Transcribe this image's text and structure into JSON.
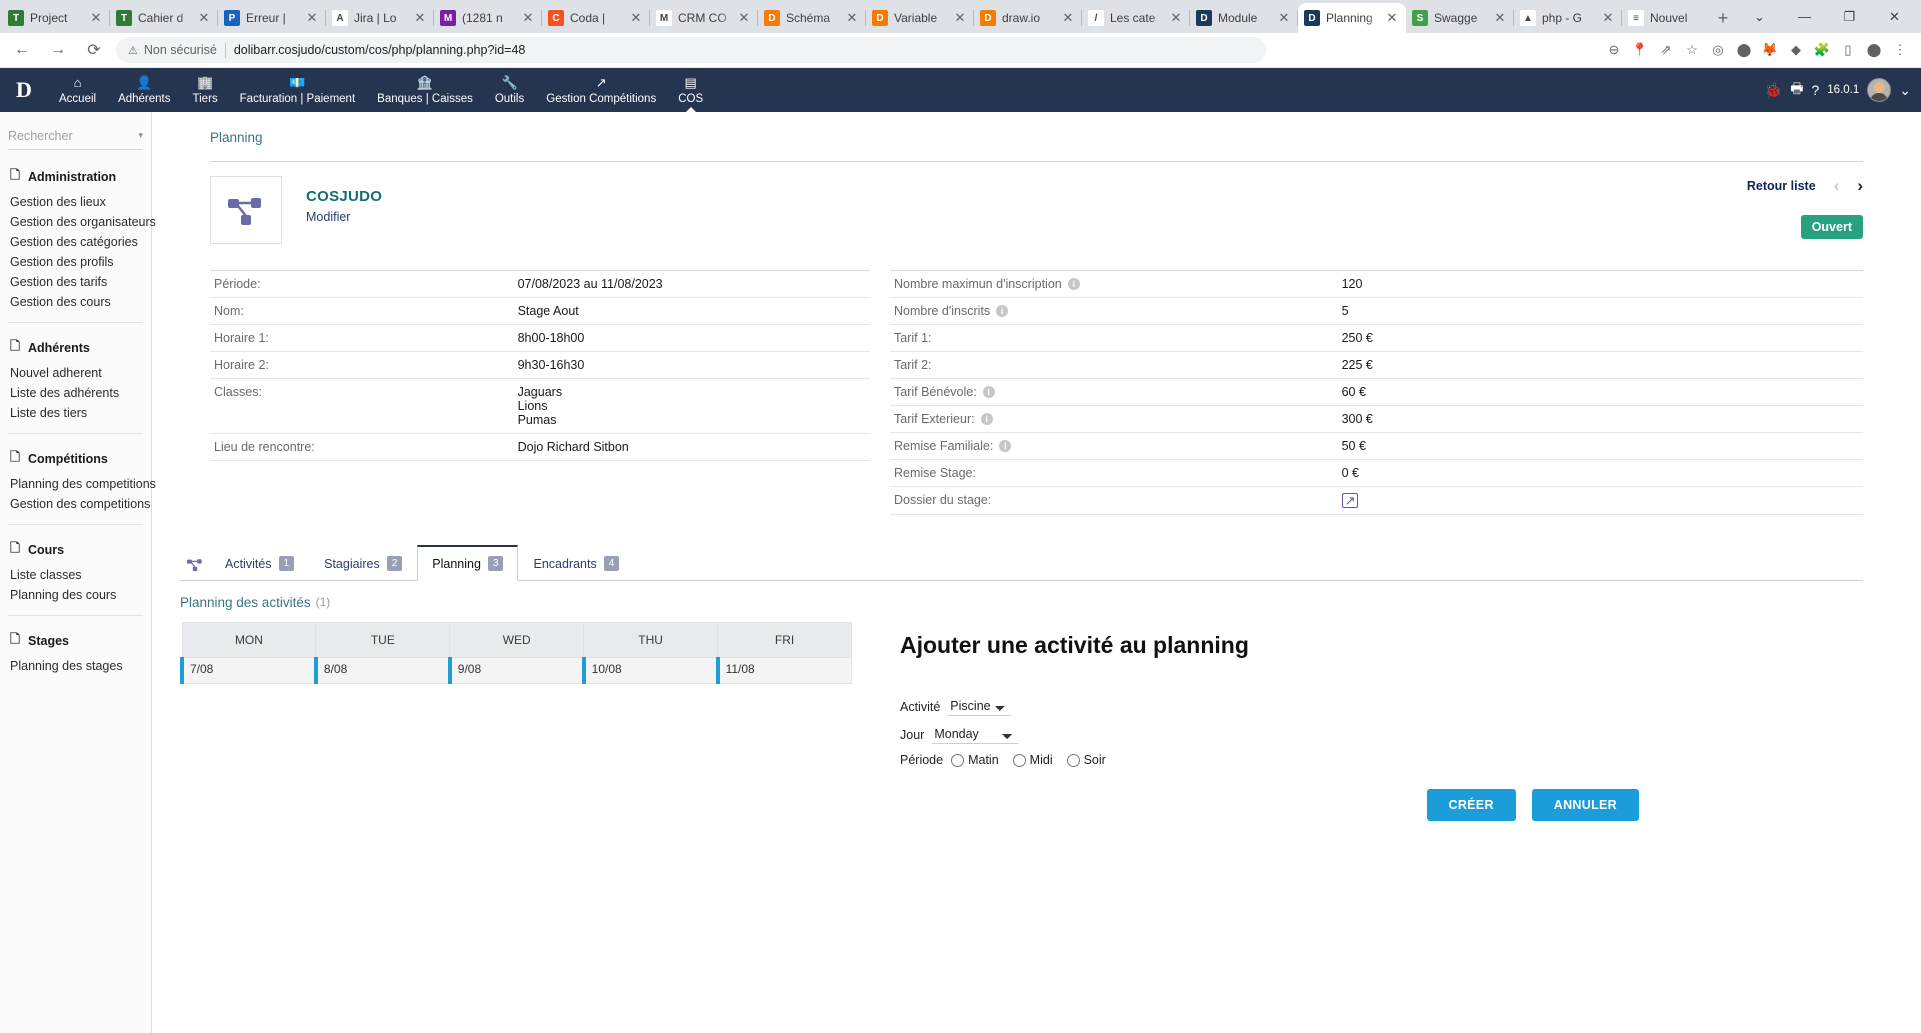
{
  "browser": {
    "tabs": [
      {
        "label": "Project",
        "icon": "trello-icon",
        "color": "#2e7d32",
        "glyph": "T"
      },
      {
        "label": "Cahier d",
        "icon": "trello-icon",
        "color": "#2e7d32",
        "glyph": "T"
      },
      {
        "label": "Erreur |",
        "icon": "pitest-icon",
        "color": "#1565c0",
        "glyph": "P"
      },
      {
        "label": "Jira | Lo",
        "icon": "jira-icon",
        "color": "#ffffff",
        "glyph": "A"
      },
      {
        "label": "(1281 n",
        "icon": "mail-icon",
        "color": "#7b1fa2",
        "glyph": "M"
      },
      {
        "label": "Coda | ",
        "icon": "coda-icon",
        "color": "#f4511e",
        "glyph": "C"
      },
      {
        "label": "CRM CO",
        "icon": "crm-icon",
        "color": "#ffffff",
        "glyph": "M"
      },
      {
        "label": "Schéma",
        "icon": "drawio-icon",
        "color": "#f57c00",
        "glyph": "D"
      },
      {
        "label": "Variable",
        "icon": "drawio-icon",
        "color": "#f57c00",
        "glyph": "D"
      },
      {
        "label": "draw.io",
        "icon": "drawio-icon",
        "color": "#f57c00",
        "glyph": "D"
      },
      {
        "label": "Les cate",
        "icon": "pencil-icon",
        "color": "#ffffff",
        "glyph": "/"
      },
      {
        "label": "Module",
        "icon": "dolibarr-icon",
        "color": "#1a3a5c",
        "glyph": "D"
      },
      {
        "label": "Planning",
        "icon": "dolibarr-icon",
        "color": "#1a3a5c",
        "glyph": "D",
        "active": true
      },
      {
        "label": "Swagge",
        "icon": "swagger-icon",
        "color": "#43a047",
        "glyph": "S"
      },
      {
        "label": "php - G",
        "icon": "drive-icon",
        "color": "#ffffff",
        "glyph": "▲"
      },
      {
        "label": "Nouvel",
        "icon": "sheets-icon",
        "color": "#ffffff",
        "glyph": "≡"
      }
    ],
    "new_tab_glyph": "+",
    "window_controls": [
      "⌄",
      "—",
      "❐",
      "✕"
    ],
    "back_glyph": "←",
    "forward_glyph": "→",
    "reload_glyph": "⟳",
    "security_warning_icon": "⚠",
    "security_label": "Non sécurisé",
    "url": "dolibarr.cosjudo/custom/cos/php/planning.php?id=48",
    "toolbar_icons": [
      "zoom-out-icon",
      "location-icon",
      "share-icon",
      "bookmark-star-icon",
      "pocket-icon",
      "adblock-icon",
      "metamask-icon",
      "extension-purple-icon",
      "puzzle-icon",
      "sidepanel-icon",
      "profile-icon",
      "menu-kebab-icon"
    ]
  },
  "app_navbar": {
    "brand": "D",
    "items": [
      {
        "label": "Accueil",
        "icon": "home-icon",
        "glyph": "⌂"
      },
      {
        "label": "Adhérents",
        "icon": "user-icon",
        "glyph": "👤"
      },
      {
        "label": "Tiers",
        "icon": "building-icon",
        "glyph": "🏢"
      },
      {
        "label": "Facturation | Paiement",
        "icon": "invoice-icon",
        "glyph": "💶"
      },
      {
        "label": "Banques | Caisses",
        "icon": "bank-icon",
        "glyph": "🏦"
      },
      {
        "label": "Outils",
        "icon": "wrench-icon",
        "glyph": "🔧"
      },
      {
        "label": "Gestion Compétitions",
        "icon": "arrow-up-right-icon",
        "glyph": "↗"
      },
      {
        "label": "COS",
        "icon": "page-icon",
        "glyph": "▤",
        "active": true
      }
    ],
    "right": {
      "bug_icon": "bug-icon",
      "print_icon": "print-icon",
      "help_icon": "help-icon",
      "version": "16.0.1",
      "avatar": "user-avatar",
      "caret": "⌄"
    }
  },
  "sidebar": {
    "search_placeholder": "Rechercher",
    "groups": [
      {
        "title": "Administration",
        "links": [
          "Gestion des lieux",
          "Gestion des organisateurs",
          "Gestion des catégories",
          "Gestion des profils",
          "Gestion des tarifs",
          "Gestion des cours"
        ]
      },
      {
        "title": "Adhérents",
        "links": [
          "Nouvel adherent",
          "Liste des adhérents",
          "Liste des tiers"
        ]
      },
      {
        "title": "Compétitions",
        "links": [
          "Planning des competitions",
          "Gestion des competitions"
        ]
      },
      {
        "title": "Cours",
        "links": [
          "Liste classes",
          "Planning des cours"
        ]
      },
      {
        "title": "Stages",
        "links": [
          "Planning des stages"
        ]
      }
    ]
  },
  "main": {
    "breadcrumb": "Planning",
    "card": {
      "title": "COSJUDO",
      "subtitle": "Modifier",
      "back_to_list": "Retour liste",
      "prev_glyph": "‹",
      "next_glyph": "›",
      "status": "Ouvert"
    },
    "left_fields": [
      {
        "label": "Période:",
        "value": "07/08/2023 au 11/08/2023"
      },
      {
        "label": "Nom:",
        "value": "Stage Aout"
      },
      {
        "label": "Horaire 1:",
        "value": "8h00-18h00"
      },
      {
        "label": "Horaire 2:",
        "value": "9h30-16h30"
      },
      {
        "label": "Classes:",
        "value": "Jaguars\nLions\nPumas"
      },
      {
        "label": "Lieu de rencontre:",
        "value": "Dojo Richard Sitbon"
      }
    ],
    "right_fields": [
      {
        "label": "Nombre maximun d'inscription",
        "info": true,
        "value": "120"
      },
      {
        "label": "Nombre d'inscrits",
        "info": true,
        "value": "5"
      },
      {
        "label": "Tarif 1:",
        "info": false,
        "value": "250 €"
      },
      {
        "label": "Tarif 2:",
        "info": false,
        "value": "225 €"
      },
      {
        "label": "Tarif Bénévole:",
        "info": true,
        "value": "60 €"
      },
      {
        "label": "Tarif Exterieur:",
        "info": true,
        "value": "300 €"
      },
      {
        "label": "Remise Familiale:",
        "info": true,
        "value": "50 €"
      },
      {
        "label": "Remise Stage:",
        "info": false,
        "value": "0 €"
      },
      {
        "label": "Dossier du stage:",
        "info": false,
        "value": "",
        "link_icon": "external-link-icon"
      }
    ],
    "tabs": [
      {
        "label": "Activités",
        "badge": "1",
        "active": false
      },
      {
        "label": "Stagiaires",
        "badge": "2",
        "active": false
      },
      {
        "label": "Planning",
        "badge": "3",
        "active": true
      },
      {
        "label": "Encadrants",
        "badge": "4",
        "active": false
      }
    ],
    "section": {
      "title": "Planning des activités",
      "count": "(1)"
    },
    "calendar": {
      "headers": [
        "MON",
        "TUE",
        "WED",
        "THU",
        "FRI"
      ],
      "dates": [
        "7/08",
        "8/08",
        "9/08",
        "10/08",
        "11/08"
      ]
    },
    "form": {
      "title": "Ajouter une activité au planning",
      "activity_label": "Activité",
      "activity_value": "Piscine",
      "activity_options": [
        "Piscine"
      ],
      "day_label": "Jour",
      "day_value": "Monday",
      "day_options": [
        "Monday"
      ],
      "period_label": "Période",
      "period_options": [
        "Matin",
        "Midi",
        "Soir"
      ],
      "create_label": "CRÉER",
      "cancel_label": "ANNULER"
    }
  },
  "colors": {
    "navbar": "#26354f",
    "accent_teal": "#14706e",
    "status_green": "#27a17e",
    "button_blue": "#1b9dd9",
    "calendar_blue": "#1f9ed4"
  }
}
